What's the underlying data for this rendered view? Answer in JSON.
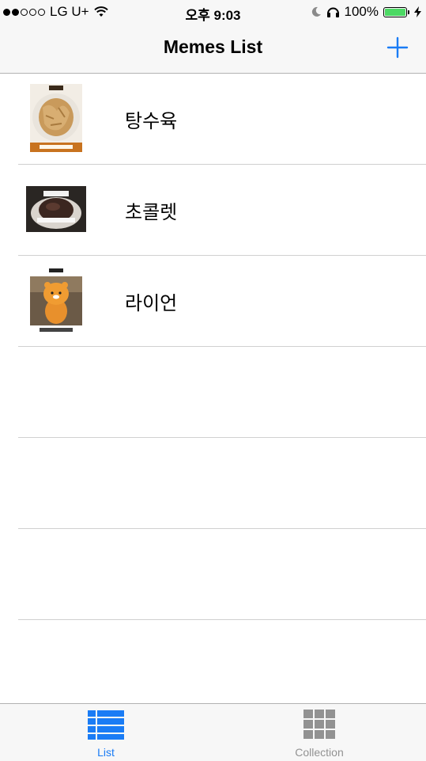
{
  "status_bar": {
    "carrier": "LG U+",
    "time": "오후 9:03",
    "battery_percent": "100%",
    "signal_bars_filled": 2,
    "signal_bars_total": 5
  },
  "nav": {
    "title": "Memes List",
    "add_icon": "plus-icon"
  },
  "memes": [
    {
      "label": "탕수육",
      "thumb_caption": "존 내드릴까",
      "thumb_top": "탕수육"
    },
    {
      "label": "초콜렛",
      "thumb_caption": "",
      "thumb_top": "초콜렛"
    },
    {
      "label": "라이언",
      "thumb_caption": "또 뭐 주거 할까",
      "thumb_top": "라이언"
    }
  ],
  "tabs": [
    {
      "label": "List",
      "icon": "list-icon",
      "selected": true
    },
    {
      "label": "Collection",
      "icon": "grid-icon",
      "selected": false
    }
  ],
  "colors": {
    "accent": "#1a7cf5",
    "inactive": "#929292",
    "battery": "#4cd964"
  }
}
